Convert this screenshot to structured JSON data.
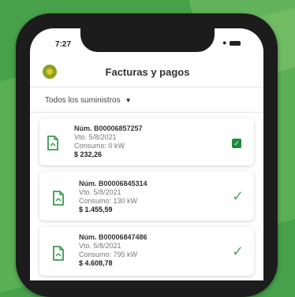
{
  "status_bar": {
    "time": "7:27"
  },
  "header": {
    "title": "Facturas y pagos",
    "logo_icon": "brand-logo"
  },
  "filter": {
    "label": "Todos los suministros"
  },
  "invoices": [
    {
      "number": "Núm. B00006857257",
      "due": "Vto. 5/8/2021",
      "consumption": "Consumo: 0 kW",
      "amount": "$ 232,26",
      "state": "selected"
    },
    {
      "number": "Núm. B00006845314",
      "due": "Vto. 5/8/2021",
      "consumption": "Consumo: 130 kW",
      "amount": "$ 1.455,59",
      "state": "paid"
    },
    {
      "number": "Núm. B00006847486",
      "due": "Vto. 5/8/2021",
      "consumption": "Consumo: 795 kW",
      "amount": "$ 4.608,78",
      "state": "paid"
    }
  ],
  "colors": {
    "brand_green": "#46a14a",
    "check_green": "#1e8a3a",
    "icon_green": "#3c9a4e"
  }
}
